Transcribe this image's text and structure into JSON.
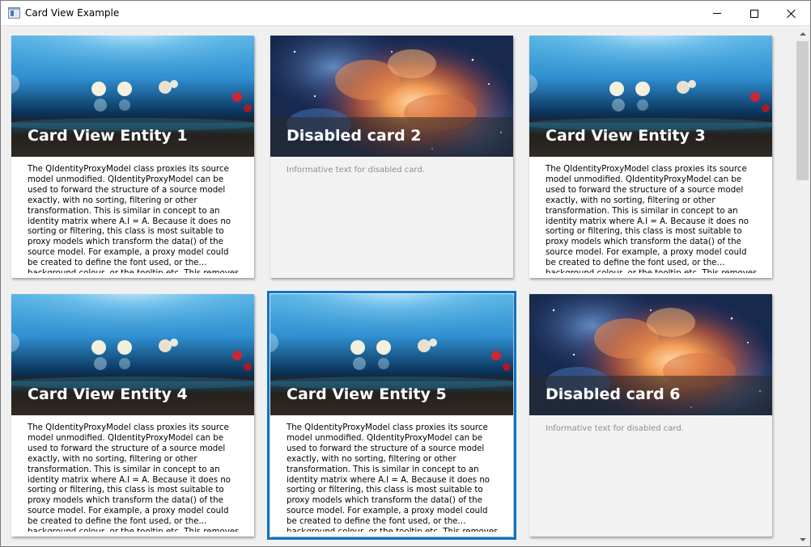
{
  "window": {
    "title": "Card View Example"
  },
  "cards": [
    {
      "title": "Card View Entity 1",
      "text": "The QIdentityProxyModel class proxies its source model unmodified. QIdentityProxyModel can be used to forward the structure of a source model exactly, with no sorting, filtering or other transformation. This is similar in concept to an identity matrix where A.I = A. Because it does no sorting or filtering, this class is most suitable to proxy models which transform the data() of the source model. For example, a proxy model could be created to define the font used, or the background colour, or the tooltip etc. This removes the need to implement all data handling in the same class that creates the structure of the model.",
      "image": "bokeh-lights",
      "state": "enabled"
    },
    {
      "title": "Disabled card 2",
      "text": "Informative text for disabled card.",
      "image": "nebula",
      "state": "disabled"
    },
    {
      "title": "Card View Entity 3",
      "text": "The QIdentityProxyModel class proxies its source model unmodified. QIdentityProxyModel can be used to forward the structure of a source model exactly, with no sorting, filtering or other transformation. This is similar in concept to an identity matrix where A.I = A. Because it does no sorting or filtering, this class is most suitable to proxy models which transform the data() of the source model. For example, a proxy model could be created to define the font used, or the background colour, or the tooltip etc. This removes the need to implement all data handling in the same class that creates the structure of the model.",
      "image": "bokeh-lights",
      "state": "enabled"
    },
    {
      "title": "Card View Entity 4",
      "text": "The QIdentityProxyModel class proxies its source model unmodified. QIdentityProxyModel can be used to forward the structure of a source model exactly, with no sorting, filtering or other transformation. This is similar in concept to an identity matrix where A.I = A. Because it does no sorting or filtering, this class is most suitable to proxy models which transform the data() of the source model. For example, a proxy model could be created to define the font used, or the background colour, or the tooltip etc. This removes the need to implement all data handling in the same class that creates the structure of the model.",
      "image": "bokeh-lights",
      "state": "enabled"
    },
    {
      "title": "Card View Entity 5",
      "text": "The QIdentityProxyModel class proxies its source model unmodified. QIdentityProxyModel can be used to forward the structure of a source model exactly, with no sorting, filtering or other transformation. This is similar in concept to an identity matrix where A.I = A. Because it does no sorting or filtering, this class is most suitable to proxy models which transform the data() of the source model. For example, a proxy model could be created to define the font used, or the background colour, or the tooltip etc. This removes the need to implement all data handling in the same class that creates the structure of the model.",
      "image": "bokeh-lights",
      "state": "selected"
    },
    {
      "title": "Disabled card 6",
      "text": "Informative text for disabled card.",
      "image": "nebula",
      "state": "disabled"
    }
  ],
  "colors": {
    "selection": "#0a74c7",
    "disabled_text": "#8e8e8e"
  }
}
